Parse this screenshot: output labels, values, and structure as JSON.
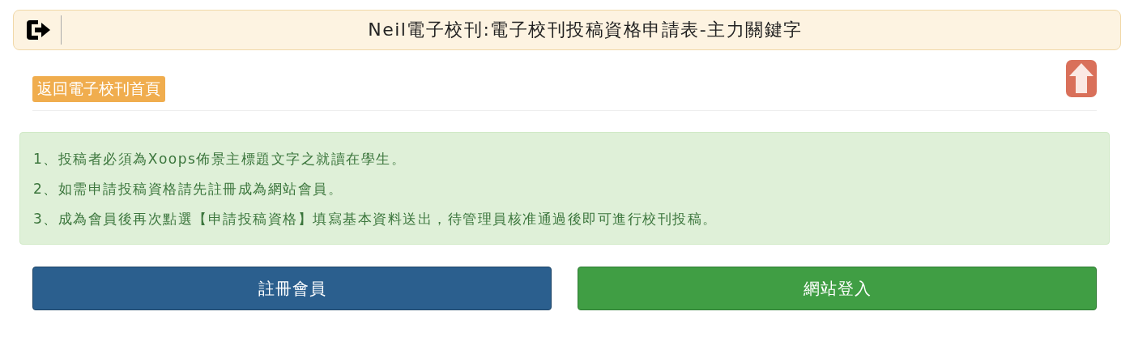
{
  "header": {
    "title": "Neil電子校刊:電子校刊投稿資格申請表-主力關鍵字"
  },
  "back_link": "返回電子校刊首頁",
  "notice": [
    "1、投稿者必須為Xoops佈景主標題文字之就讀在學生。",
    "2、如需申請投稿資格請先註冊成為網站會員。",
    "3、成為會員後再次點選【申請投稿資格】填寫基本資料送出，待管理員核准通過後即可進行校刊投稿。"
  ],
  "buttons": [
    {
      "label": "註冊會員",
      "kind": "primary"
    },
    {
      "label": "網站登入",
      "kind": "success"
    }
  ]
}
